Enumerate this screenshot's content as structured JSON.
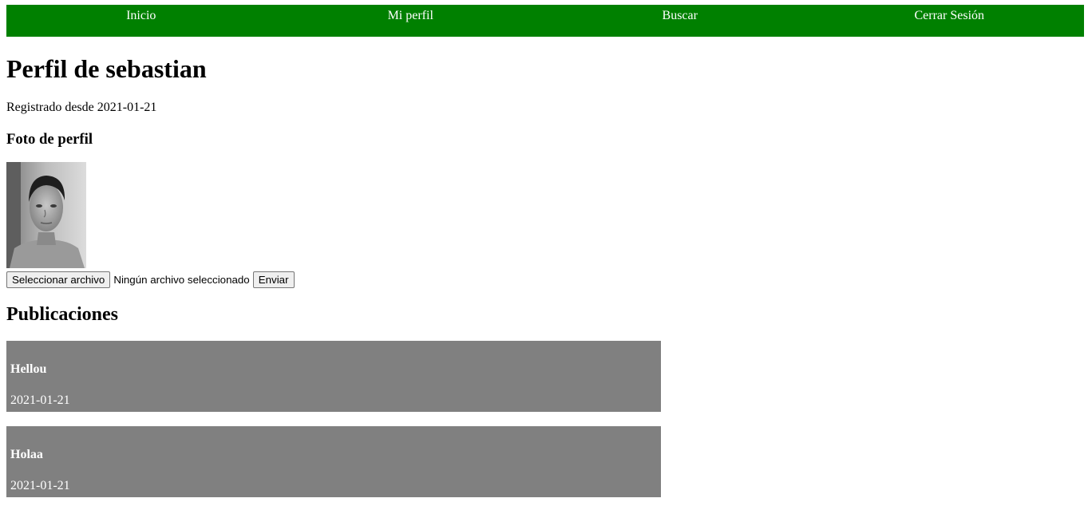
{
  "nav": {
    "items": [
      {
        "label": "Inicio"
      },
      {
        "label": "Mi perfil"
      },
      {
        "label": "Buscar"
      },
      {
        "label": "Cerrar Sesión"
      }
    ]
  },
  "profile": {
    "title": "Perfil de sebastian",
    "registered": "Registrado desde 2021-01-21",
    "photo_heading": "Foto de perfil"
  },
  "upload": {
    "select_label": "Seleccionar archivo",
    "status": "Ningún archivo seleccionado",
    "submit_label": "Enviar"
  },
  "posts": {
    "heading": "Publicaciones",
    "items": [
      {
        "title": "Hellou",
        "date": "2021-01-21"
      },
      {
        "title": "Holaa",
        "date": "2021-01-21"
      }
    ]
  },
  "colors": {
    "nav_bg": "#008000",
    "post_bg": "#808080"
  }
}
